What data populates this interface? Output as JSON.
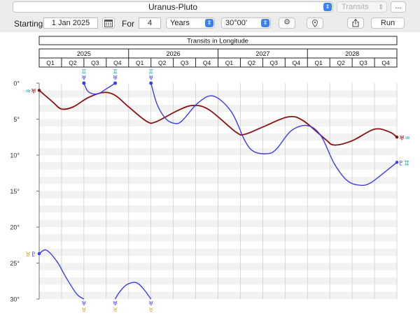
{
  "toolbar": {
    "pair_select": "Uranus-Pluto",
    "mode_select": "Transits",
    "more_label": "...",
    "starting_label": "Starting",
    "starting_value": "1 Jan 2025",
    "for_label": "For",
    "for_value": "4",
    "unit_select": "Years",
    "orb_select": "30°00'",
    "run_label": "Run",
    "icons": [
      "calendar-icon",
      "gear-icon",
      "location-pin-icon",
      "share-icon"
    ]
  },
  "colors": {
    "accent": "#3b82f6",
    "uranus_line": "#8b1010",
    "pluto_line": "#3b3bf0",
    "grid_stripe": "#f2f2f2",
    "grid_line": "#cfcfcf"
  },
  "chart_data": {
    "type": "line",
    "title": "Transits in Longitude",
    "years": [
      "2025",
      "2026",
      "2027",
      "2028"
    ],
    "quarters": [
      "Q1",
      "Q2",
      "Q3",
      "Q4"
    ],
    "xlim": [
      2025.0,
      2029.0
    ],
    "ylim": [
      0,
      30
    ],
    "y_ticks": [
      "0°",
      "5°",
      "10°",
      "15°",
      "20°",
      "25°",
      "30°"
    ],
    "y_tick_values": [
      0,
      5,
      10,
      15,
      20,
      25,
      30
    ],
    "series": [
      {
        "glyph": "♅",
        "color": "#8b1010",
        "sign_left": "♒",
        "sign_right": "♒",
        "x": [
          2025.0,
          2025.15,
          2025.25,
          2025.38,
          2025.55,
          2025.72,
          2025.85,
          2026.0,
          2026.2,
          2026.3,
          2026.55,
          2026.72,
          2026.9,
          2027.2,
          2027.3,
          2027.5,
          2027.78,
          2027.95,
          2028.2,
          2028.3,
          2028.5,
          2028.75,
          2028.92,
          2029.0
        ],
        "values": [
          1.0,
          2.6,
          3.6,
          3.3,
          2.0,
          1.3,
          1.7,
          3.3,
          5.3,
          5.4,
          3.8,
          3.1,
          3.7,
          6.8,
          7.1,
          6.1,
          4.7,
          5.2,
          7.8,
          8.6,
          8.0,
          6.4,
          6.8,
          7.5
        ]
      },
      {
        "glyph": "♇",
        "color": "#3b3bf0",
        "sign_left": "♉",
        "sign_right": "♊",
        "segments": [
          {
            "x": [
              2025.0,
              2025.08,
              2025.2,
              2025.3,
              2025.42,
              2025.5
            ],
            "values": [
              23.7,
              23.2,
              24.8,
              27.0,
              29.3,
              30.0
            ],
            "end_markers": [
              false,
              false
            ]
          },
          {
            "x": [
              2025.5,
              2025.55,
              2025.65,
              2025.75,
              2025.85
            ],
            "values": [
              0.0,
              1.2,
              1.5,
              0.8,
              0.0
            ],
            "end_markers": [
              true,
              true
            ]
          },
          {
            "x": [
              2025.85,
              2025.9,
              2025.98,
              2026.08,
              2026.16,
              2026.25
            ],
            "values": [
              30.0,
              29.0,
              28.0,
              27.7,
              28.5,
              30.0
            ],
            "end_markers": [
              false,
              false
            ]
          },
          {
            "x": [
              2026.25,
              2026.32,
              2026.42,
              2026.52,
              2026.6,
              2026.78,
              2026.95,
              2027.15,
              2027.3,
              2027.4,
              2027.55,
              2027.65,
              2027.82,
              2028.0,
              2028.15,
              2028.3,
              2028.45,
              2028.6,
              2028.7,
              2028.8,
              2029.0
            ],
            "values": [
              0.0,
              3.0,
              5.0,
              5.6,
              5.2,
              2.7,
              1.8,
              4.0,
              8.0,
              9.5,
              9.8,
              9.2,
              6.6,
              5.9,
              7.3,
              11.2,
              13.6,
              14.2,
              13.9,
              13.0,
              11.0
            ],
            "end_markers": [
              true,
              false
            ]
          }
        ]
      }
    ],
    "markers": [
      {
        "x": 2025.5,
        "edge": "top",
        "glyph": "♅",
        "sign": "♊"
      },
      {
        "x": 2025.85,
        "edge": "top",
        "glyph": "♅",
        "sign": "♊"
      },
      {
        "x": 2026.25,
        "edge": "top",
        "glyph": "♅",
        "sign": "♊"
      },
      {
        "x": 2025.5,
        "edge": "bottom",
        "glyph": "♅",
        "sign": "♉"
      },
      {
        "x": 2025.85,
        "edge": "bottom",
        "glyph": "♅",
        "sign": "♉"
      },
      {
        "x": 2026.25,
        "edge": "bottom",
        "glyph": "♅",
        "sign": "♉"
      }
    ]
  }
}
